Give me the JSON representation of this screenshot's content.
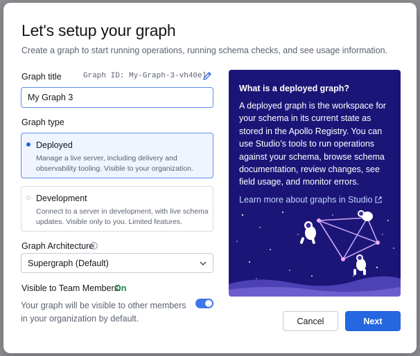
{
  "modal": {
    "title": "Let's setup your graph",
    "subtitle": "Create a graph to start running operations, running schema checks, and see usage information."
  },
  "graph_title": {
    "label": "Graph title",
    "graph_id": "Graph ID: My-Graph-3-vh40el",
    "value": "My Graph 3",
    "edit_icon": "pencil-icon"
  },
  "graph_type": {
    "label": "Graph type",
    "options": [
      {
        "title": "Deployed",
        "description": "Manage a live server, including delivery and observability tooling. Visible to your organization.",
        "selected": true
      },
      {
        "title": "Development",
        "description": "Connect to a server in development, with live schema updates. Visible only to you. Limited features.",
        "selected": false
      }
    ]
  },
  "architecture": {
    "label": "Graph Architecture",
    "info_icon": "info-icon",
    "selected": "Supergraph (Default)"
  },
  "visibility": {
    "label": "Visible to Team Members:",
    "state": "On",
    "description": "Your graph will be visible to other members in your organization by default.",
    "enabled": true
  },
  "info_panel": {
    "title": "What is a deployed graph?",
    "body": "A deployed graph is the workspace for your schema in its current state as stored in the Apollo Registry. You can use Studio’s tools to run operations against your schema, browse schema documentation, review changes, see field usage, and monitor errors.",
    "link": "Learn more about graphs in Studio",
    "link_icon": "external-link-icon",
    "background": "#1c1578"
  },
  "buttons": {
    "cancel": "Cancel",
    "next": "Next"
  },
  "colors": {
    "accent": "#2567e0",
    "on_state": "#1c8448"
  }
}
